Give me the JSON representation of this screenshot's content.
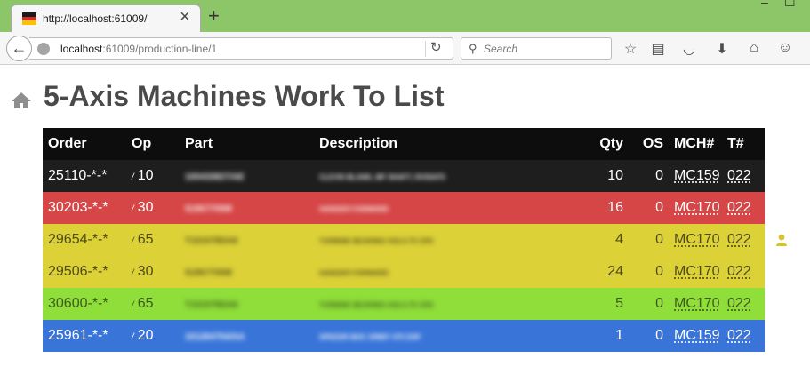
{
  "browser": {
    "tab_title": "http://localhost:61009/",
    "url_host": "localhost",
    "url_rest": ":61009/production-line/1",
    "search_placeholder": "Search",
    "favicon_colors": [
      "#1a1a1a",
      "#d62b2b",
      "#f5c400"
    ]
  },
  "page": {
    "title": "5-Axis Machines Work To List"
  },
  "table": {
    "headers": {
      "order": "Order",
      "op": "Op",
      "part": "Part",
      "description": "Description",
      "qty": "Qty",
      "os": "OS",
      "mch": "MCH#",
      "t": "T#"
    },
    "rows": [
      {
        "order": "25110-*-*",
        "op_prefix": "/",
        "op": "10",
        "part": "100433827/AE",
        "description": "CLEVIS BLANK, 8IF SHAFT, RVS0475",
        "qty": "10",
        "os": "0",
        "mch": "MC159",
        "t": "022",
        "color": "black"
      },
      {
        "order": "30203-*-*",
        "op_prefix": "/",
        "op": "30",
        "part": "519577/008",
        "description": "HANGER FORWARD",
        "qty": "16",
        "os": "0",
        "mch": "MC170",
        "t": "022",
        "color": "red"
      },
      {
        "order": "29654-*-*",
        "op_prefix": "/",
        "op": "65",
        "part": "T101078DA6",
        "description": "TURBINE BEARING H32.0.75 CRS",
        "qty": "4",
        "os": "0",
        "mch": "MC170",
        "t": "022",
        "color": "yellow"
      },
      {
        "order": "29506-*-*",
        "op_prefix": "/",
        "op": "30",
        "part": "519577/008",
        "description": "HANGER FORWARD",
        "qty": "24",
        "os": "0",
        "mch": "MC170",
        "t": "022",
        "color": "yellow"
      },
      {
        "order": "30600-*-*",
        "op_prefix": "/",
        "op": "65",
        "part": "T101078DA6",
        "description": "TURBINE BEARING H32.0.75 CRS",
        "qty": "5",
        "os": "0",
        "mch": "MC170",
        "t": "022",
        "color": "green"
      },
      {
        "order": "25961-*-*",
        "op_prefix": "/",
        "op": "20",
        "part": "101264754/AA",
        "description": "SPEEDR BOC ORBIT 475 DSP",
        "qty": "1",
        "os": "0",
        "mch": "MC159",
        "t": "022",
        "color": "blue"
      }
    ]
  },
  "icons": {
    "home": "home-icon",
    "user": "user-icon"
  },
  "colors": {
    "header_bg": "#0d0d0d",
    "row_black": "#1e1e1e",
    "row_red": "#d64646",
    "row_yellow": "#ddd138",
    "row_green": "#8fde3a",
    "row_blue": "#3975d9",
    "title_bar": "#8dc569",
    "user_marker": "#d6c22e"
  }
}
